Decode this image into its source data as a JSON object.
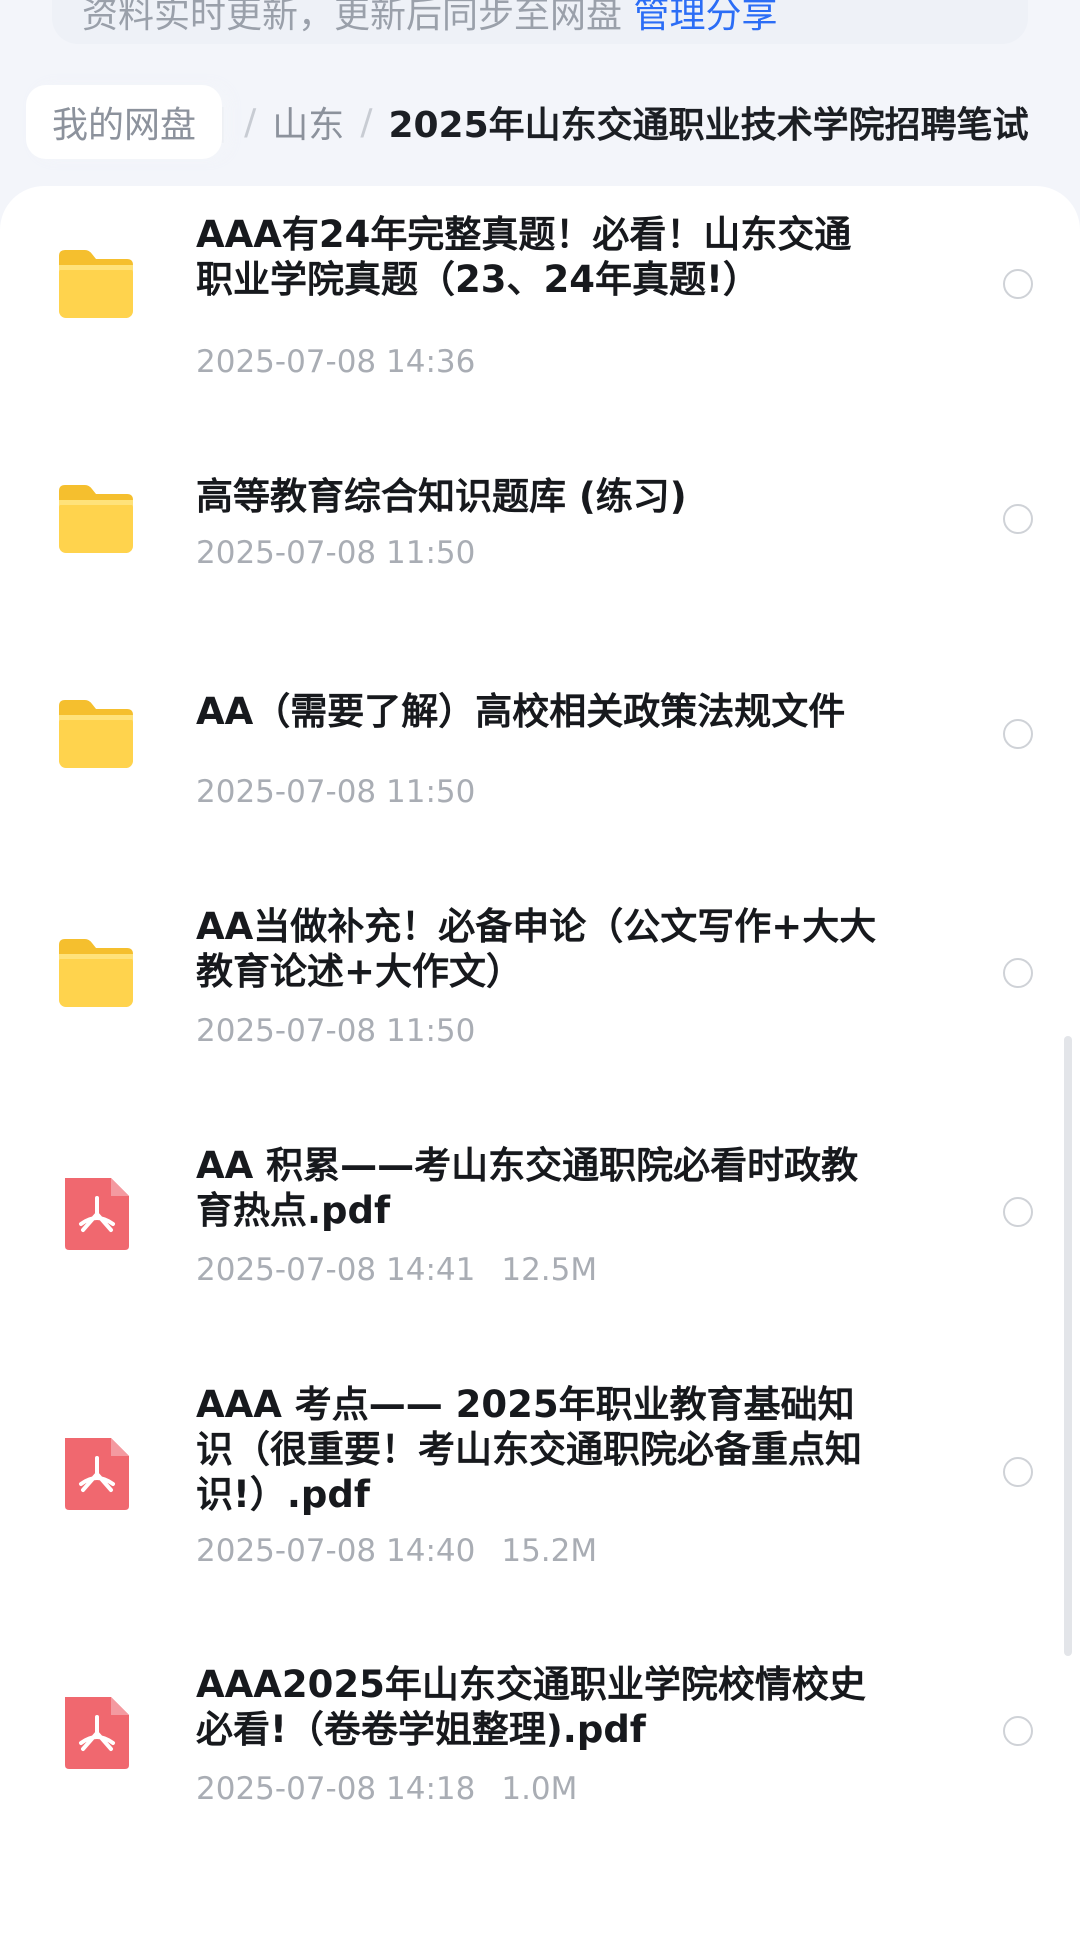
{
  "top_notice": {
    "text": "资料实时更新，更新后同步至网盘",
    "link": "管理分享"
  },
  "breadcrumb": {
    "root": "我的网盘",
    "separator": "/",
    "middle": "山东",
    "current": "2025年山东交通职业技术学院招聘笔试"
  },
  "files": [
    {
      "type": "folder",
      "icon": "folder-icon",
      "name": "AAA有24年完整真题！必看！山东交通职业学院真题（23、24年真题!）",
      "date": "2025-07-08 14:36",
      "size": ""
    },
    {
      "type": "folder",
      "icon": "folder-icon",
      "name": "高等教育综合知识题库 (练习)",
      "date": "2025-07-08 11:50",
      "size": ""
    },
    {
      "type": "folder",
      "icon": "folder-icon",
      "name": "AA（需要了解）高校相关政策法规文件",
      "date": "2025-07-08 11:50",
      "size": ""
    },
    {
      "type": "folder",
      "icon": "folder-icon",
      "name": "AA当做补充！必备申论（公文写作+大大教育论述+大作文）",
      "date": "2025-07-08 11:50",
      "size": ""
    },
    {
      "type": "pdf",
      "icon": "pdf-icon",
      "name": "AA 积累——考山东交通职院必看时政教育热点.pdf",
      "date": "2025-07-08 14:41",
      "size": "12.5M"
    },
    {
      "type": "pdf",
      "icon": "pdf-icon",
      "name": "AAA 考点—— 2025年职业教育基础知识（很重要！考山东交通职院必备重点知识!）.pdf",
      "date": "2025-07-08 14:40",
      "size": "15.2M"
    },
    {
      "type": "pdf",
      "icon": "pdf-icon",
      "name": "AAA2025年山东交通职业学院校情校史必看!（卷卷学姐整理).pdf",
      "date": "2025-07-08 14:18",
      "size": "1.0M"
    }
  ],
  "colors": {
    "folder": "#ffd34d",
    "pdf": "#f0686f",
    "link": "#2b6df6"
  }
}
